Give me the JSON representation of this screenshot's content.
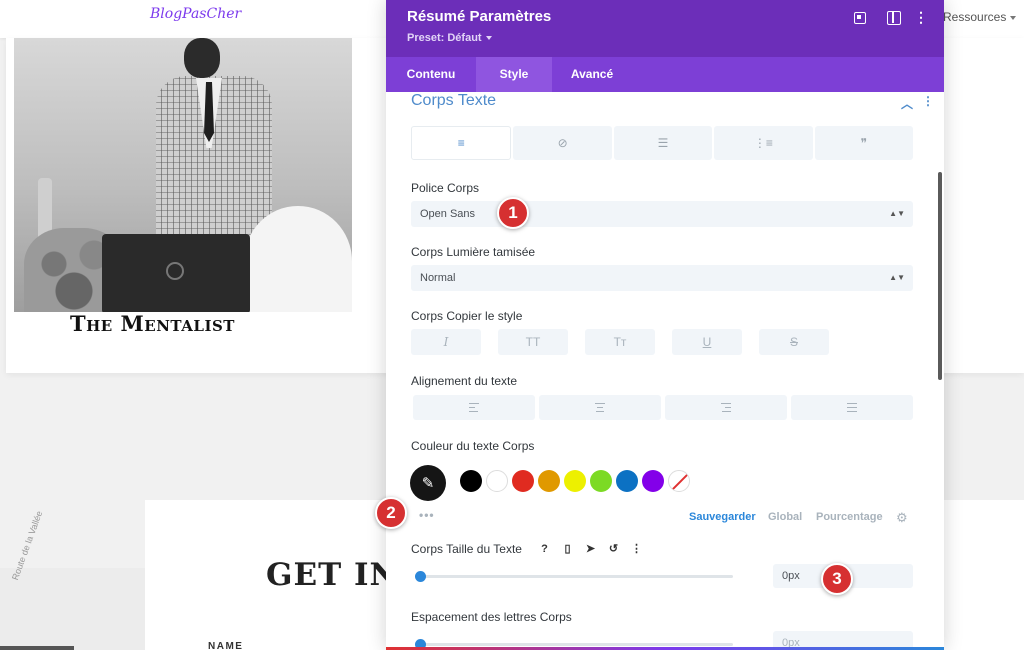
{
  "site": {
    "logo": "BlogPasCher",
    "nav_item": "Ressources",
    "profile_caption": "The Mentalist",
    "contact_heading": "GET IN",
    "form_name_label": "NAME",
    "map_road_label": "Route de la Vallée"
  },
  "modal": {
    "title": "Résumé Paramètres",
    "preset": "Preset: Défaut",
    "tabs": [
      {
        "label": "Contenu"
      },
      {
        "label": "Style",
        "active": true
      },
      {
        "label": "Avancé"
      }
    ],
    "section": {
      "title": "Corps Texte",
      "text_type_tabs": [
        {
          "icon": "paragraph-align-icon",
          "glyph": "≡",
          "active": true
        },
        {
          "icon": "link-icon",
          "glyph": "⊘"
        },
        {
          "icon": "unordered-list-icon",
          "glyph": "☰"
        },
        {
          "icon": "ordered-list-icon",
          "glyph": "⋮≡"
        },
        {
          "icon": "quote-icon",
          "glyph": "❞"
        }
      ],
      "font": {
        "label": "Police Corps",
        "value": "Open Sans"
      },
      "weight": {
        "label": "Corps Lumière tamisée",
        "value": "Normal"
      },
      "style": {
        "label": "Corps Copier le style",
        "buttons": [
          {
            "name": "italic-button",
            "glyph": "I"
          },
          {
            "name": "uppercase-button",
            "glyph": "TT"
          },
          {
            "name": "capitalize-button",
            "glyph": "Tт"
          },
          {
            "name": "underline-button",
            "glyph": "U"
          },
          {
            "name": "strikethrough-button",
            "glyph": "S"
          }
        ]
      },
      "alignment": {
        "label": "Alignement du texte"
      },
      "color": {
        "label": "Couleur du texte Corps",
        "swatches": [
          "#000000",
          "#ffffff",
          "#e02b20",
          "#e09900",
          "#edf000",
          "#7cda24",
          "#0c71c3",
          "#8300e9"
        ],
        "actions": {
          "save": "Sauvegarder",
          "global": "Global",
          "percentage": "Pourcentage"
        }
      },
      "size": {
        "label": "Corps Taille du Texte",
        "value": "0px",
        "slider_fraction": 0
      },
      "spacing": {
        "label": "Espacement des lettres Corps",
        "value": "0px",
        "slider_fraction": 0
      }
    }
  },
  "annotations": [
    "1",
    "2",
    "3"
  ],
  "colors": {
    "modal_header": "#6c2eb9",
    "modal_tabs": "#7d3fd6",
    "accent_blue": "#2b87da",
    "badge_red": "#d63031"
  }
}
